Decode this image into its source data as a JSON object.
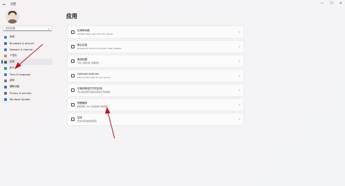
{
  "window": {
    "title": "设置",
    "back_icon": "back-arrow-icon"
  },
  "controls": {
    "minimize": "—",
    "maximize": "☐",
    "close": "✕"
  },
  "search": {
    "placeholder": "查找设置"
  },
  "nav": [
    {
      "label": "系统",
      "color": "#3b7fd6"
    },
    {
      "label": "Bluetooth & devices",
      "color": "#2a6fcf"
    },
    {
      "label": "Network & internet",
      "color": "#3a86d9"
    },
    {
      "label": "个性化",
      "color": "#d48a3a"
    },
    {
      "label": "应用",
      "color": "#555555",
      "active": true
    },
    {
      "label": "帐户",
      "color": "#2a9d5c"
    },
    {
      "label": "Time & language",
      "color": "#3b7fd6"
    },
    {
      "label": "游戏",
      "color": "#777777"
    },
    {
      "label": "辅助功能",
      "color": "#2d6cc8"
    },
    {
      "label": "Privacy & security",
      "color": "#6a6a6a"
    },
    {
      "label": "Windows Update",
      "color": "#2a6fcf"
    }
  ],
  "page": {
    "title": "应用"
  },
  "cards": [
    {
      "title": "应用和功能",
      "subtitle": "Installed apps, app execution aliases"
    },
    {
      "title": "默认应用",
      "subtitle": "Defaults for file and link types, other defaults"
    },
    {
      "title": "离线地图",
      "subtitle": "下载, 存储位置, 地图更新"
    },
    {
      "title": "Optional features",
      "subtitle": "Extra functionality for your device"
    },
    {
      "title": "可使用网站打开的应用",
      "subtitle": "可以在应用而不是浏览器中打开的网站"
    },
    {
      "title": "视频播放",
      "subtitle": "视频调整, HDR 流式处理, 电池选项"
    },
    {
      "title": "启动",
      "subtitle": "登录时自动启动的应用"
    }
  ],
  "accent": "#005fb8",
  "annotation_color": "#c0131b"
}
